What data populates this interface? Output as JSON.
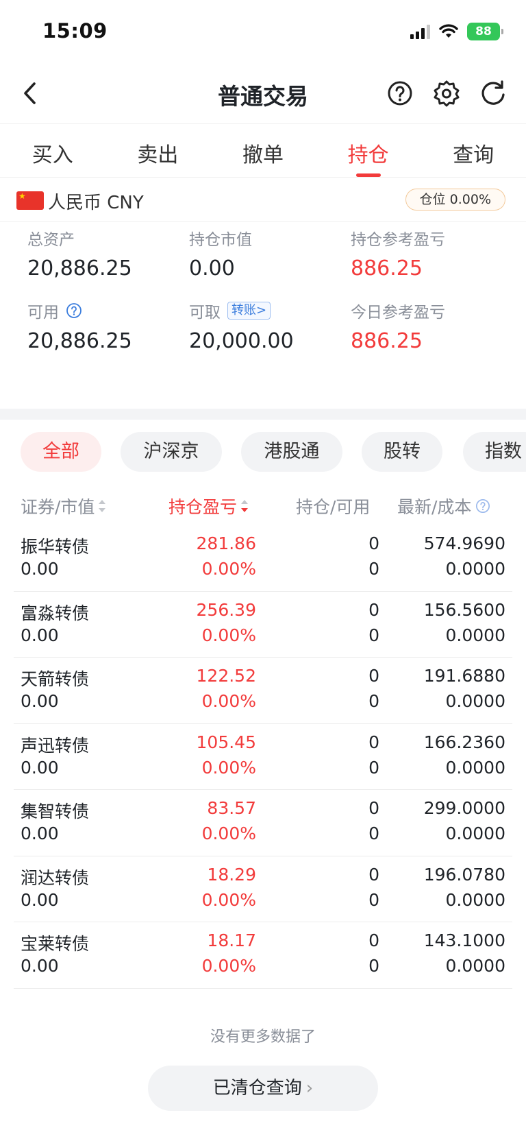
{
  "status_bar": {
    "time": "15:09",
    "battery": "88"
  },
  "nav": {
    "title": "普通交易"
  },
  "tabs": [
    {
      "label": "买入"
    },
    {
      "label": "卖出"
    },
    {
      "label": "撤单"
    },
    {
      "label": "持仓",
      "active": true
    },
    {
      "label": "查询"
    }
  ],
  "account": {
    "currency": "人民币 CNY",
    "position_ratio": "仓位 0.00%",
    "total_assets_label": "总资产",
    "total_assets": "20,886.25",
    "market_value_label": "持仓市值",
    "market_value": "0.00",
    "position_pl_label": "持仓参考盈亏",
    "position_pl": "886.25",
    "available_label": "可用",
    "available": "20,886.25",
    "withdrawable_label": "可取",
    "transfer_label": "转账>",
    "withdrawable": "20,000.00",
    "today_pl_label": "今日参考盈亏",
    "today_pl": "886.25"
  },
  "filters": [
    "全部",
    "沪深京",
    "港股通",
    "股转",
    "指数"
  ],
  "table": {
    "headers": {
      "security": "证券/市值",
      "pl": "持仓盈亏",
      "position": "持仓/可用",
      "price": "最新/成本"
    },
    "rows": [
      {
        "name": "振华转债",
        "market_value": "0.00",
        "pl": "281.86",
        "pl_pct": "0.00%",
        "position": "0",
        "available": "0",
        "last": "574.9690",
        "cost": "0.0000"
      },
      {
        "name": "富淼转债",
        "market_value": "0.00",
        "pl": "256.39",
        "pl_pct": "0.00%",
        "position": "0",
        "available": "0",
        "last": "156.5600",
        "cost": "0.0000"
      },
      {
        "name": "天箭转债",
        "market_value": "0.00",
        "pl": "122.52",
        "pl_pct": "0.00%",
        "position": "0",
        "available": "0",
        "last": "191.6880",
        "cost": "0.0000"
      },
      {
        "name": "声迅转债",
        "market_value": "0.00",
        "pl": "105.45",
        "pl_pct": "0.00%",
        "position": "0",
        "available": "0",
        "last": "166.2360",
        "cost": "0.0000"
      },
      {
        "name": "集智转债",
        "market_value": "0.00",
        "pl": "83.57",
        "pl_pct": "0.00%",
        "position": "0",
        "available": "0",
        "last": "299.0000",
        "cost": "0.0000"
      },
      {
        "name": "润达转债",
        "market_value": "0.00",
        "pl": "18.29",
        "pl_pct": "0.00%",
        "position": "0",
        "available": "0",
        "last": "196.0780",
        "cost": "0.0000"
      },
      {
        "name": "宝莱转债",
        "market_value": "0.00",
        "pl": "18.17",
        "pl_pct": "0.00%",
        "position": "0",
        "available": "0",
        "last": "143.1000",
        "cost": "0.0000"
      }
    ]
  },
  "footer": {
    "no_more": "没有更多数据了",
    "cleared_button": "已清仓查询"
  },
  "colors": {
    "accent": "#f23b3b",
    "link": "#3b7ddd",
    "battery": "#34c759"
  }
}
